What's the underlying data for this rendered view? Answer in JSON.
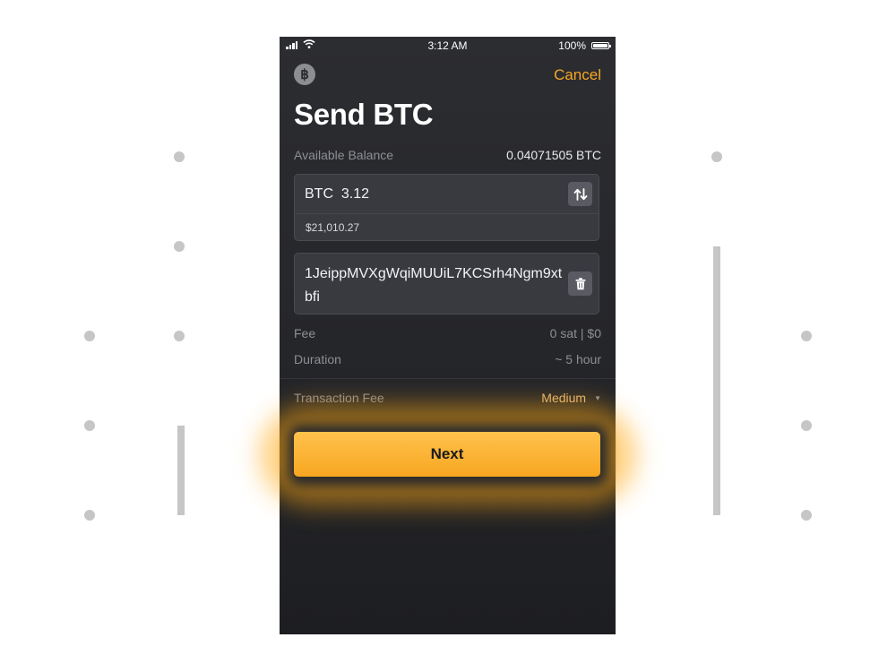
{
  "status_bar": {
    "time": "3:12 AM",
    "battery": "100%",
    "battery_level": 1.0
  },
  "header": {
    "logo_icon": "bitcoin-icon",
    "logo_glyph": "฿",
    "cancel_label": "Cancel",
    "title": "Send BTC"
  },
  "balance": {
    "label": "Available Balance",
    "value": "0.04071505 BTC"
  },
  "amount": {
    "text": "BTC  3.12",
    "fiat": "$21,010.27",
    "swap_icon": "swap-arrows-icon"
  },
  "address": {
    "value": "1JeippMVXgWqiMUUiL7KCSrh4Ngm9xtbfi",
    "delete_icon": "trash-icon"
  },
  "fee": {
    "label": "Fee",
    "value": "0 sat | $0"
  },
  "duration": {
    "label": "Duration",
    "value": "~ 5 hour"
  },
  "transaction_fee": {
    "label": "Transaction Fee",
    "selected": "Medium",
    "dropdown_icon": "caret-down-icon"
  },
  "next_label": "Next",
  "colors": {
    "accent": "#f7a823",
    "button": "#ffb531",
    "background": "#2a2b2f"
  }
}
